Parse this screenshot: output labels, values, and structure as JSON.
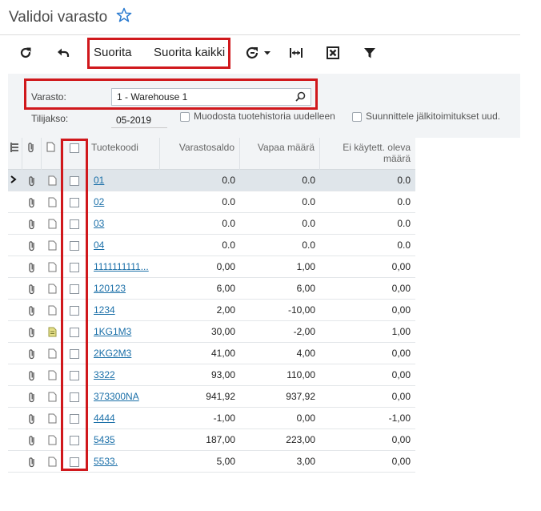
{
  "page": {
    "title": "Validoi varasto"
  },
  "toolbar": {
    "run_label": "Suorita",
    "run_all_label": "Suorita kaikki"
  },
  "form": {
    "warehouse_label": "Varasto:",
    "warehouse_value": "1 - Warehouse 1",
    "period_label": "Tilijakso:",
    "period_value": "05-2019",
    "rebuild_history_label": "Muodosta tuotehistoria uudelleen",
    "plan_backorders_label": "Suunnittele jälkitoimitukset uud."
  },
  "grid": {
    "columns": {
      "code": "Tuotekoodi",
      "stock": "Varastosaldo",
      "available": "Vapaa määrä",
      "unused": "Ei käytett. oleva määrä"
    },
    "rows": [
      {
        "code": "01",
        "stock": "0.0",
        "available": "0.0",
        "unused": "0.0",
        "note": false
      },
      {
        "code": "02",
        "stock": "0.0",
        "available": "0.0",
        "unused": "0.0",
        "note": false
      },
      {
        "code": "03",
        "stock": "0.0",
        "available": "0.0",
        "unused": "0.0",
        "note": false
      },
      {
        "code": "04",
        "stock": "0.0",
        "available": "0.0",
        "unused": "0.0",
        "note": false
      },
      {
        "code": "1111111111...",
        "stock": "0,00",
        "available": "1,00",
        "unused": "0,00",
        "note": false
      },
      {
        "code": "120123",
        "stock": "6,00",
        "available": "6,00",
        "unused": "0,00",
        "note": false
      },
      {
        "code": "1234",
        "stock": "2,00",
        "available": "-10,00",
        "unused": "0,00",
        "note": false
      },
      {
        "code": "1KG1M3",
        "stock": "30,00",
        "available": "-2,00",
        "unused": "1,00",
        "note": true
      },
      {
        "code": "2KG2M3",
        "stock": "41,00",
        "available": "4,00",
        "unused": "0,00",
        "note": false
      },
      {
        "code": "3322",
        "stock": "93,00",
        "available": "110,00",
        "unused": "0,00",
        "note": false
      },
      {
        "code": "373300NA",
        "stock": "941,92",
        "available": "937,92",
        "unused": "0,00",
        "note": false
      },
      {
        "code": "4444",
        "stock": "-1,00",
        "available": "0,00",
        "unused": "-1,00",
        "note": false
      },
      {
        "code": "5435",
        "stock": "187,00",
        "available": "223,00",
        "unused": "0,00",
        "note": false
      },
      {
        "code": "5533.",
        "stock": "5,00",
        "available": "3,00",
        "unused": "0,00",
        "note": false
      }
    ]
  },
  "colors": {
    "highlight": "#d0181c",
    "link": "#1a6fa8",
    "star": "#2b7bd0"
  }
}
